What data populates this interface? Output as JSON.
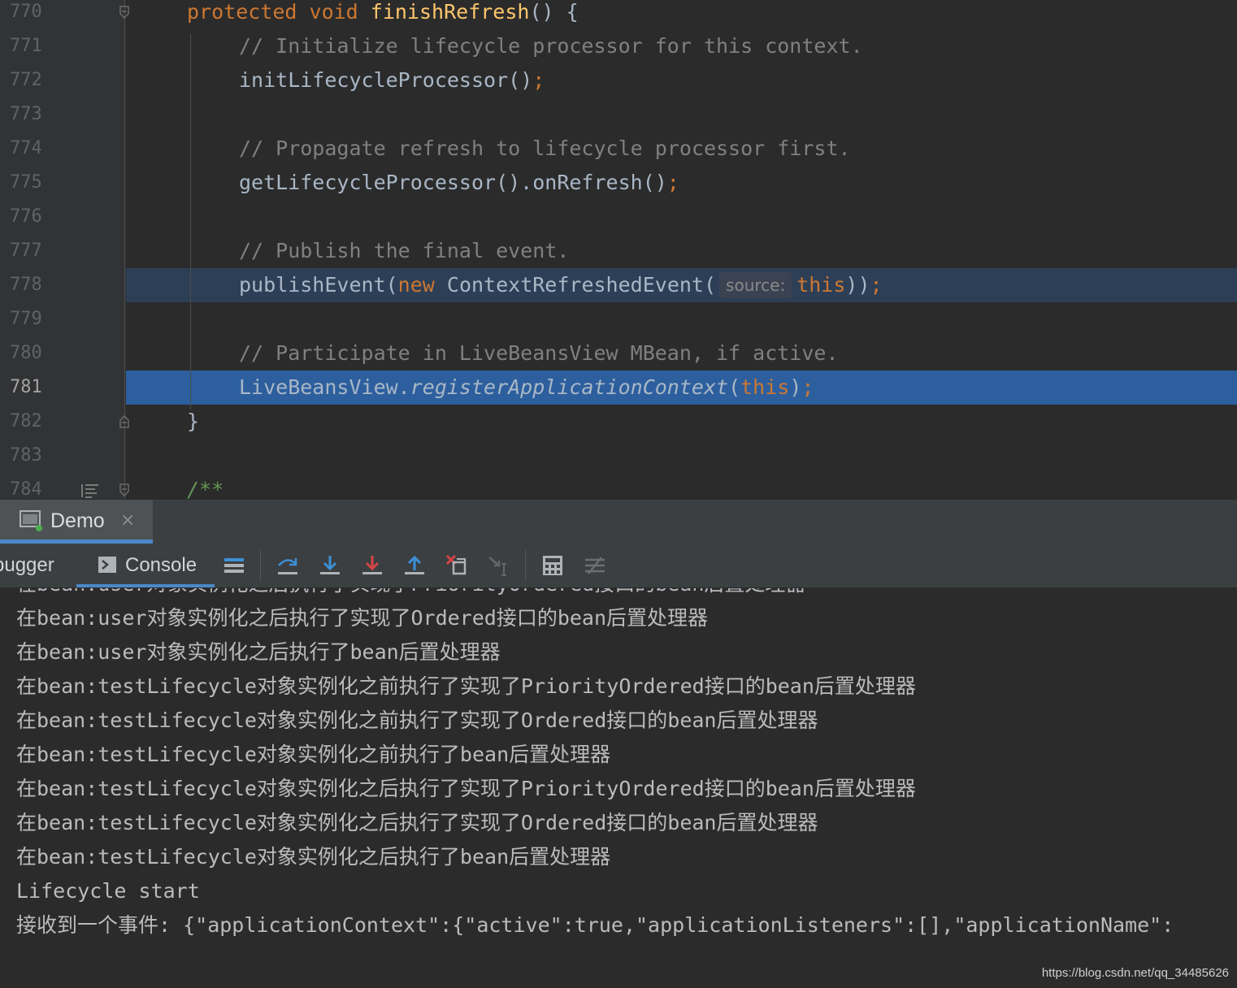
{
  "editor": {
    "lines": [
      {
        "num": "770",
        "tokens": [
          {
            "t": "protected ",
            "c": "kw"
          },
          {
            "t": "void ",
            "c": "kw"
          },
          {
            "t": "finishRefresh",
            "c": "fn"
          },
          {
            "t": "() {",
            "c": ""
          }
        ]
      },
      {
        "num": "771",
        "tokens": [
          {
            "t": "// Initialize lifecycle processor for this context.",
            "c": "cm"
          }
        ]
      },
      {
        "num": "772",
        "tokens": [
          {
            "t": "initLifecycleProcessor()",
            "c": ""
          },
          {
            "t": ";",
            "c": "kw"
          }
        ]
      },
      {
        "num": "773",
        "tokens": []
      },
      {
        "num": "774",
        "tokens": [
          {
            "t": "// Propagate refresh to lifecycle processor first.",
            "c": "cm"
          }
        ]
      },
      {
        "num": "775",
        "tokens": [
          {
            "t": "getLifecycleProcessor().onRefresh()",
            "c": ""
          },
          {
            "t": ";",
            "c": "kw"
          }
        ]
      },
      {
        "num": "776",
        "tokens": []
      },
      {
        "num": "777",
        "tokens": [
          {
            "t": "// Publish the final event.",
            "c": "cm"
          }
        ]
      },
      {
        "num": "778",
        "tokens": [
          {
            "t": "publishEvent(",
            "c": ""
          },
          {
            "t": "new ",
            "c": "kw"
          },
          {
            "t": "ContextRefreshedEvent(",
            "c": ""
          },
          {
            "t": "source:",
            "c": "hint"
          },
          {
            "t": "this",
            "c": "kw"
          },
          {
            "t": "))",
            "c": ""
          },
          {
            "t": ";",
            "c": "kw"
          }
        ]
      },
      {
        "num": "779",
        "tokens": []
      },
      {
        "num": "780",
        "tokens": [
          {
            "t": "// Participate in LiveBeansView MBean, if active.",
            "c": "cm"
          }
        ]
      },
      {
        "num": "781",
        "tokens": [
          {
            "t": "LiveBeansView.",
            "c": ""
          },
          {
            "t": "registerApplicationContext",
            "c": "it"
          },
          {
            "t": "(",
            "c": ""
          },
          {
            "t": "this",
            "c": "kw"
          },
          {
            "t": ")",
            "c": ""
          },
          {
            "t": ";",
            "c": "kw"
          }
        ]
      },
      {
        "num": "782",
        "tokens": [
          {
            "t": "}",
            "c": ""
          }
        ]
      },
      {
        "num": "783",
        "tokens": []
      },
      {
        "num": "784",
        "tokens": [
          {
            "t": "/**",
            "c": "doc"
          }
        ]
      }
    ]
  },
  "run_tab": {
    "label": "Demo",
    "close": "×"
  },
  "toolbar": {
    "debugger_label": "bugger",
    "console_label": "Console"
  },
  "console": {
    "partial_line": "在bean:user对象实例化之后执行了实现了PriorityOrdered接口的bean后置处理器",
    "lines": [
      "在bean:user对象实例化之后执行了实现了Ordered接口的bean后置处理器",
      "在bean:user对象实例化之后执行了bean后置处理器",
      "在bean:testLifecycle对象实例化之前执行了实现了PriorityOrdered接口的bean后置处理器",
      "在bean:testLifecycle对象实例化之前执行了实现了Ordered接口的bean后置处理器",
      "在bean:testLifecycle对象实例化之前执行了bean后置处理器",
      "在bean:testLifecycle对象实例化之后执行了实现了PriorityOrdered接口的bean后置处理器",
      "在bean:testLifecycle对象实例化之后执行了实现了Ordered接口的bean后置处理器",
      "在bean:testLifecycle对象实例化之后执行了bean后置处理器",
      "Lifecycle start",
      "接收到一个事件: {\"applicationContext\":{\"active\":true,\"applicationListeners\":[],\"applicationName\":"
    ]
  },
  "watermark": "https://blog.csdn.net/qq_34485626",
  "colors": {
    "keyword": "#cc7832",
    "function": "#ffc66d",
    "comment": "#808080",
    "current_line": "#2d5f9e",
    "exec_line": "#2d3f56",
    "accent": "#4a88c7"
  }
}
